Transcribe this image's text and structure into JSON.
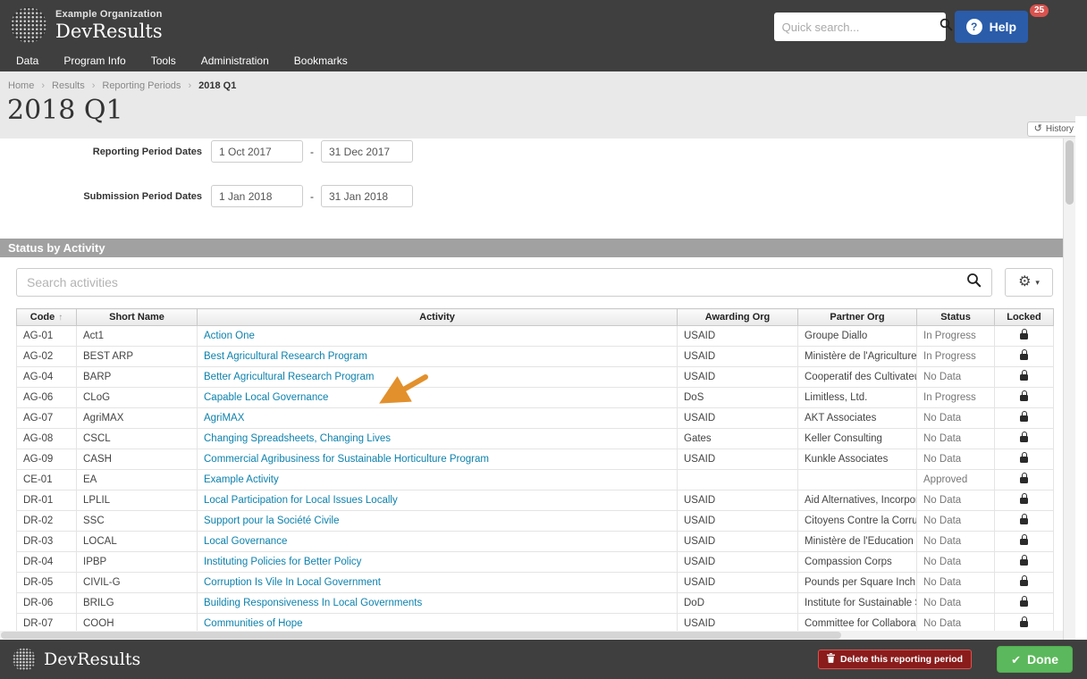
{
  "header": {
    "org_name": "Example Organization",
    "app_name": "DevResults",
    "quick_search_placeholder": "Quick search...",
    "help_label": "Help",
    "help_icon": "?",
    "notification_count": "25"
  },
  "nav": {
    "items": [
      "Data",
      "Program Info",
      "Tools",
      "Administration",
      "Bookmarks"
    ]
  },
  "breadcrumb": {
    "items": [
      "Home",
      "Results",
      "Reporting Periods",
      "2018 Q1"
    ]
  },
  "page": {
    "title": "2018 Q1",
    "history_label": "History"
  },
  "form": {
    "reporting_period": {
      "label": "Reporting Period Dates",
      "start": "1 Oct 2017",
      "end": "31 Dec 2017"
    },
    "submission_period": {
      "label": "Submission Period Dates",
      "start": "1 Jan 2018",
      "end": "31 Jan 2018"
    },
    "range_separator": "-"
  },
  "activity_section": {
    "title": "Status by Activity",
    "search_placeholder": "Search activities"
  },
  "table": {
    "columns": [
      "Code",
      "Short Name",
      "Activity",
      "Awarding Org",
      "Partner Org",
      "Status",
      "Locked"
    ],
    "sorted_by": "Code",
    "sort_direction": "asc",
    "rows": [
      {
        "code": "AG-01",
        "short_name": "Act1",
        "activity": "Action One",
        "awarding_org": "USAID",
        "partner_org": "Groupe Diallo",
        "status": "In Progress",
        "locked": true
      },
      {
        "code": "AG-02",
        "short_name": "BEST ARP",
        "activity": "Best Agricultural Research Program",
        "awarding_org": "USAID",
        "partner_org": "Ministère de l'Agriculture",
        "status": "In Progress",
        "locked": true
      },
      {
        "code": "AG-04",
        "short_name": "BARP",
        "activity": "Better Agricultural Research Program",
        "awarding_org": "USAID",
        "partner_org": "Cooperatif des Cultivateurs",
        "status": "No Data",
        "locked": true
      },
      {
        "code": "AG-06",
        "short_name": "CLoG",
        "activity": "Capable Local Governance",
        "awarding_org": "DoS",
        "partner_org": "Limitless, Ltd.",
        "status": "In Progress",
        "locked": true
      },
      {
        "code": "AG-07",
        "short_name": "AgriMAX",
        "activity": "AgriMAX",
        "awarding_org": "USAID",
        "partner_org": "AKT Associates",
        "status": "No Data",
        "locked": true
      },
      {
        "code": "AG-08",
        "short_name": "CSCL",
        "activity": "Changing Spreadsheets, Changing Lives",
        "awarding_org": "Gates",
        "partner_org": "Keller Consulting",
        "status": "No Data",
        "locked": true
      },
      {
        "code": "AG-09",
        "short_name": "CASH",
        "activity": "Commercial Agribusiness for Sustainable Horticulture Program",
        "awarding_org": "USAID",
        "partner_org": "Kunkle Associates",
        "status": "No Data",
        "locked": true
      },
      {
        "code": "CE-01",
        "short_name": "EA",
        "activity": "Example Activity",
        "awarding_org": "",
        "partner_org": "",
        "status": "Approved",
        "locked": true
      },
      {
        "code": "DR-01",
        "short_name": "LPLIL",
        "activity": "Local Participation for Local Issues Locally",
        "awarding_org": "USAID",
        "partner_org": "Aid Alternatives, Incorporated",
        "status": "No Data",
        "locked": true
      },
      {
        "code": "DR-02",
        "short_name": "SSC",
        "activity": "Support pour la Société Civile",
        "awarding_org": "USAID",
        "partner_org": "Citoyens Contre la Corruption",
        "status": "No Data",
        "locked": true
      },
      {
        "code": "DR-03",
        "short_name": "LOCAL",
        "activity": "Local Governance",
        "awarding_org": "USAID",
        "partner_org": "Ministère de l'Education",
        "status": "No Data",
        "locked": true
      },
      {
        "code": "DR-04",
        "short_name": "IPBP",
        "activity": "Instituting Policies for Better Policy",
        "awarding_org": "USAID",
        "partner_org": "Compassion Corps",
        "status": "No Data",
        "locked": true
      },
      {
        "code": "DR-05",
        "short_name": "CIVIL-G",
        "activity": "Corruption Is Vile In Local Government",
        "awarding_org": "USAID",
        "partner_org": "Pounds per Square Inch",
        "status": "No Data",
        "locked": true
      },
      {
        "code": "DR-06",
        "short_name": "BRILG",
        "activity": "Building Responsiveness In Local Governments",
        "awarding_org": "DoD",
        "partner_org": "Institute for Sustainable Su",
        "status": "No Data",
        "locked": true
      },
      {
        "code": "DR-07",
        "short_name": "COOH",
        "activity": "Communities of Hope",
        "awarding_org": "USAID",
        "partner_org": "Committee for Collaboration",
        "status": "No Data",
        "locked": true
      }
    ]
  },
  "footer": {
    "brand": "DevResults",
    "delete_button_label": "Delete this reporting period",
    "done_button_label": "Done"
  },
  "colors": {
    "topbar_bg": "#3f3f3f",
    "section_bar": "#a1a1a1",
    "accent_link": "#0d82ad",
    "help_button": "#2a5caa",
    "done_button": "#5cb85c",
    "delete_button_bg": "#8a1c1c",
    "delete_button_border": "#d9534f",
    "notification_badge": "#d9534f",
    "arrow_annotation": "#e2902c"
  }
}
